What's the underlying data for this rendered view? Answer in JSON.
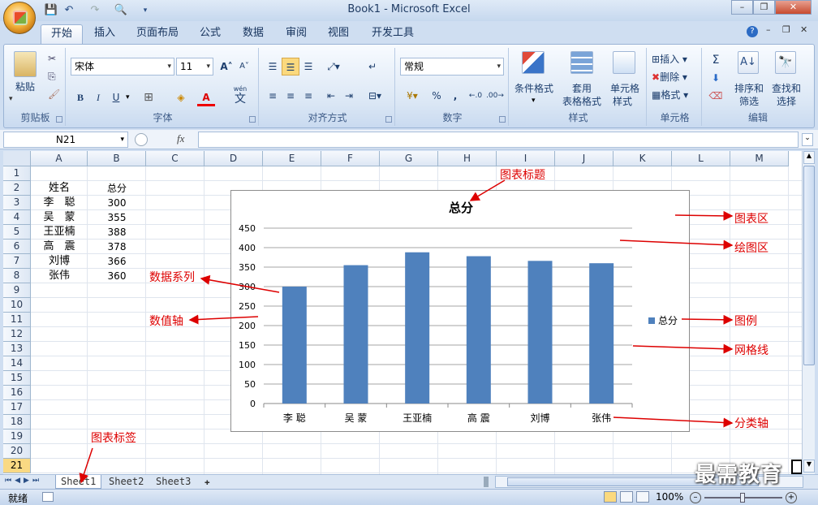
{
  "app": {
    "title": "Book1 - Microsoft Excel"
  },
  "tabs": [
    "开始",
    "插入",
    "页面布局",
    "公式",
    "数据",
    "审阅",
    "视图",
    "开发工具"
  ],
  "ribbon": {
    "clipboard": {
      "label": "剪贴板",
      "paste": "粘贴"
    },
    "font": {
      "label": "字体",
      "name": "宋体",
      "size": "11",
      "bold": "B",
      "italic": "I",
      "underline": "U",
      "grow": "A",
      "shrink": "A",
      "color_a": "A",
      "wen": "wén",
      "wen_char": "文"
    },
    "alignment": {
      "label": "对齐方式"
    },
    "number": {
      "label": "数字",
      "format": "常规",
      "percent": "%",
      "comma": ","
    },
    "styles": {
      "label": "样式",
      "conditional": "条件格式",
      "table_format_1": "套用",
      "table_format_2": "表格格式",
      "cell_style_1": "单元格",
      "cell_style_2": "样式"
    },
    "cells": {
      "label": "单元格",
      "insert": "插入",
      "delete": "删除",
      "format": "格式"
    },
    "editing": {
      "label": "编辑",
      "sort_1": "排序和",
      "sort_2": "筛选",
      "find_1": "查找和",
      "find_2": "选择",
      "sigma": "Σ"
    }
  },
  "formula_bar": {
    "name_box": "N21",
    "fx": "fx",
    "value": ""
  },
  "columns": [
    "A",
    "B",
    "C",
    "D",
    "E",
    "F",
    "G",
    "H",
    "I",
    "J",
    "K",
    "L",
    "M"
  ],
  "rows": [
    "1",
    "2",
    "3",
    "4",
    "5",
    "6",
    "7",
    "8",
    "9",
    "10",
    "11",
    "12",
    "13",
    "14",
    "15",
    "16",
    "17",
    "18",
    "19",
    "20",
    "21"
  ],
  "cells": {
    "A2": "姓名",
    "B2": "总分",
    "A3": "李　聪",
    "B3": "300",
    "A4": "吴　蒙",
    "B4": "355",
    "A5": "王亚楠",
    "B5": "388",
    "A6": "高　震",
    "B6": "378",
    "A7": "刘博",
    "B7": "366",
    "A8": "张伟",
    "B8": "360"
  },
  "chart_data": {
    "type": "bar",
    "title": "总分",
    "categories": [
      "李 聪",
      "吴 蒙",
      "王亚楠",
      "高 震",
      "刘博",
      "张伟"
    ],
    "series": [
      {
        "name": "总分",
        "values": [
          300,
          355,
          388,
          378,
          366,
          360
        ],
        "color": "#4f81bd"
      }
    ],
    "ylim": [
      0,
      450
    ],
    "yticks": [
      "0",
      "50",
      "100",
      "150",
      "200",
      "250",
      "300",
      "350",
      "400",
      "450"
    ],
    "grid": true,
    "legend": "right"
  },
  "annotations": {
    "chart_title": "图表标题",
    "chart_area": "图表区",
    "plot_area": "绘图区",
    "data_series": "数据系列",
    "value_axis": "数值轴",
    "legend": "图例",
    "gridlines": "网格线",
    "category_axis": "分类轴",
    "sheet_tab": "图表标签"
  },
  "sheets": [
    "Sheet1",
    "Sheet2",
    "Sheet3"
  ],
  "status": {
    "ready": "就绪",
    "zoom": "100%"
  },
  "watermark": "最需教育",
  "colors": {
    "accent": "#4f81bd",
    "annotation": "#dd0000"
  }
}
